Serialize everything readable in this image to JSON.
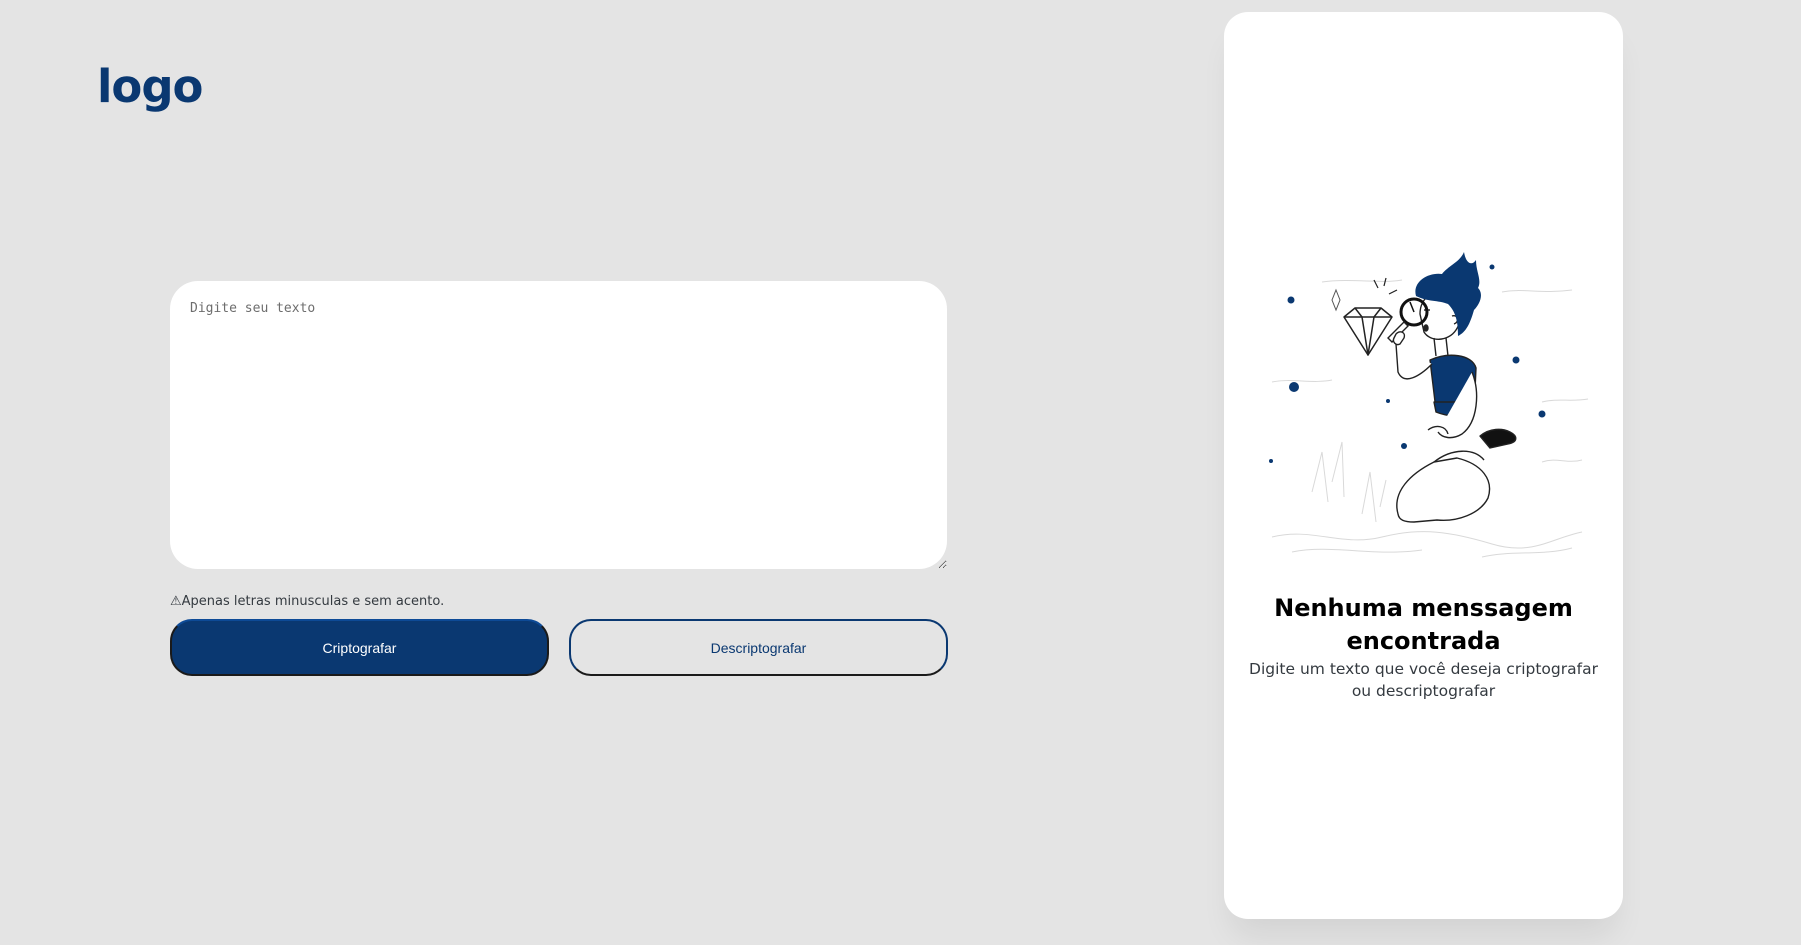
{
  "header": {
    "logo_text": "logo"
  },
  "editor": {
    "placeholder": "Digite seu texto",
    "value": ""
  },
  "warning": {
    "icon": "warning-icon",
    "text": "⚠Apenas letras minusculas e sem acento."
  },
  "actions": {
    "encrypt_label": "Criptografar",
    "decrypt_label": "Descriptografar"
  },
  "output_panel": {
    "illustration": "person-magnifying-glass-diamond",
    "title": "Nenhuma menssagem encontrada",
    "subtitle": "Digite um texto que você deseja criptografar ou descriptografar"
  },
  "colors": {
    "background": "#e4e4e4",
    "primary": "#0a3871",
    "panel": "#ffffff",
    "text": "#343a40"
  }
}
